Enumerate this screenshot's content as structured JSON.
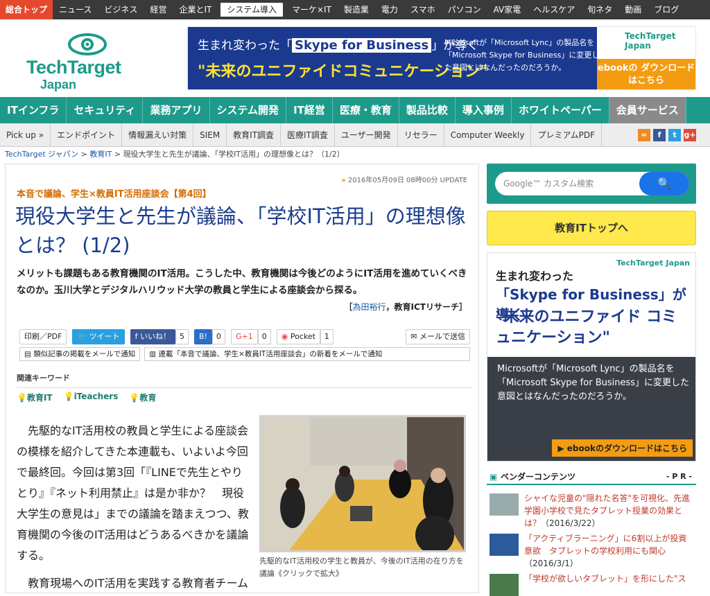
{
  "topbar": {
    "items": [
      "総合トップ",
      "ニュース",
      "ビジネス",
      "経営",
      "企業とIT",
      "システム導入",
      "マーケ×IT",
      "製造業",
      "電力",
      "スマホ",
      "パソコン",
      "AV家電",
      "ヘルスケア",
      "旬ネタ",
      "動画",
      "ブログ"
    ]
  },
  "logo": {
    "line1": "TechTarget",
    "line2": "Japan"
  },
  "banner": {
    "line1_pre": "生まれ変わった「",
    "line1_strong": "Skype for Business",
    "line1_post": "」が導く",
    "line2": "\"未来のユニファイドコミュニケーション\"",
    "line3": "Microsoftが「Microsoft Lync」の製品名を「Microsoft Skype for Business」に変更した意図とはなんだったのだろうか。",
    "brand": "TechTarget Japan",
    "cta": "ebookの ダウンロードはこちら"
  },
  "mainnav": {
    "items": [
      "ITインフラ",
      "セキュリティ",
      "業務アプリ",
      "システム開発",
      "IT経営",
      "医療・教育",
      "製品比較",
      "導入事例",
      "ホワイトペーパー",
      "会員サービス"
    ]
  },
  "subnav": {
    "items": [
      "Pick up »",
      "エンドポイント",
      "情報漏えい対策",
      "SIEM",
      "教育IT調査",
      "医療IT調査",
      "ユーザー開発",
      "リセラー",
      "Computer Weekly",
      "プレミアムPDF"
    ]
  },
  "breadcrumb": {
    "home": "TechTarget ジャパン",
    "sep1": " > ",
    "cat": "教育IT",
    "sep2": " > ",
    "current": "現役大学生と先生が議論、「学校IT活用」の理想像とは？（1/2）"
  },
  "article": {
    "date_arrow": "»",
    "date": "2016年05月09日 08時00分 UPDATE",
    "series": "本音で議論、学生×教員IT活用座談会【第4回】",
    "title": "現役大学生と先生が議論、「学校IT活用」の理想像とは？ (1/2)",
    "lead": "メリットも課題もある教育機関のIT活用。こうした中、教育機関は今後どのようにIT活用を進めていくべきなのか。玉川大学とデジタルハリウッド大学の教員と学生による座談会から探る。",
    "author_open": "［",
    "author_name": "為田裕行",
    "author_org": "，教育ICTリサーチ］",
    "tools": {
      "print": "印刷／PDF",
      "tweet": "ツイート",
      "like": "いいね！",
      "like_count": "5",
      "hatena": "B!",
      "hatena_count": "0",
      "gplus": "G+1",
      "gplus_count": "0",
      "pocket": "Pocket",
      "pocket_count": "1",
      "mail": "メールで送信",
      "notify_similar": "類似記事の掲載をメールで通知",
      "notify_series": "連載「本音で議論、学生×教員IT活用座談会」の新着をメールで通知"
    },
    "keywords_label": "関連キーワード",
    "keywords": [
      "教育IT",
      "iTeachers",
      "教育"
    ],
    "para1": "先駆的なIT活用校の教員と学生による座談会の模様を紹介してきた本連載も、いよいよ今回で最終回。今回は第3回「『LINEで先生とやりとり』『ネット利用禁止』は是か非か？　現役大学生の意見は」までの議論を踏まえつつ、教育機関の今後のIT活用はどうあるべきかを議論する。",
    "para2": "教育現場へのIT活用を実践する教育者チーム",
    "caption": "先駆的なIT活用校の学生と教員が、今後のIT活用の在り方を議論《クリックで拡大》"
  },
  "sidebar": {
    "search_placeholder": "Google™ カスタム検索",
    "edutop": "教育ITトップへ",
    "ad": {
      "a1": "生まれ変わった",
      "a2": "「Skype for Business」が導く",
      "a3": "\"未来のユニファイド コミュニケーション\"",
      "brand": "TechTarget Japan",
      "body": "Microsoftが「Microsoft Lync」の製品名を「Microsoft Skype for Business」に変更した意図とはなんだったのだろうか。",
      "cta": "▶ ebookのダウンロードはこちら"
    },
    "vendor_title": "ベンダーコンテンツ",
    "vendor_pr": "- P R -",
    "vendor_items": [
      {
        "link": "シャイな児童の\"隠れた名答\"を可視化、先進学園小学校で見たタブレット授業の効果とは？",
        "date": "（2016/3/22）"
      },
      {
        "link": "「アクティブラーニング」に6割以上が投資意欲　タブレットの学校利用にも関心",
        "date": "（2016/3/1）"
      },
      {
        "link": "「学校が欲しいタブレット」を形にした\"ス",
        "date": ""
      }
    ]
  },
  "colors": {
    "accent": "#1d9a8a",
    "title": "#1a3d8c",
    "series": "#d46b00",
    "brand": "#e5492d"
  }
}
